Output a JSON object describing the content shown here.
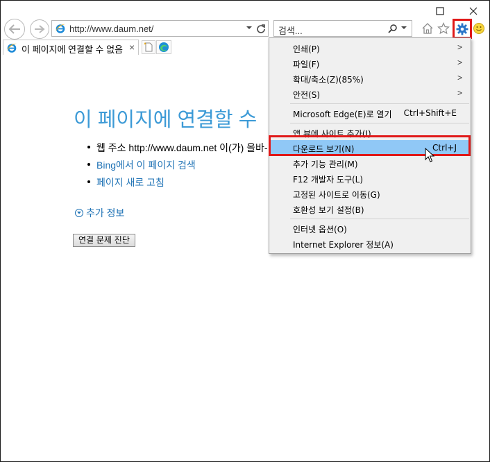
{
  "toolbar": {
    "back_label": "",
    "address_url": "http://www.daum.net/",
    "search_placeholder": "검색..."
  },
  "tab": {
    "title": "이 페이지에 연결할 수 없음",
    "close_glyph": "×"
  },
  "page": {
    "heading": "이 페이지에 연결할 수",
    "bullet_1": "웹 주소 http://www.daum.net 이(가) 올바-",
    "bullet_2": "Bing에서 이 페이지 검색",
    "bullet_3": "페이지 새로 고침",
    "more_info": "추가 정보",
    "diagnose_button": "연결 문제 진단"
  },
  "menu": {
    "items": [
      {
        "label": "인쇄(P)",
        "submenu": true
      },
      {
        "label": "파일(F)",
        "submenu": true
      },
      {
        "label": "확대/축소(Z)(85%)",
        "submenu": true
      },
      {
        "label": "안전(S)",
        "submenu": true
      },
      {
        "label": "Microsoft Edge(E)로 열기",
        "shortcut": "Ctrl+Shift+E"
      },
      {
        "label": "앱 뷰에 사이트 추가(I)"
      },
      {
        "label": "다운로드 보기(N)",
        "shortcut": "Ctrl+J",
        "highlighted": true
      },
      {
        "label": "추가 기능 관리(M)"
      },
      {
        "label": "F12 개발자 도구(L)"
      },
      {
        "label": "고정된 사이트로 이동(G)"
      },
      {
        "label": "호환성 보기 설정(B)"
      },
      {
        "label": "인터넷 옵션(O)"
      },
      {
        "label": "Internet Explorer 정보(A)"
      }
    ]
  },
  "colors": {
    "accent_blue": "#3c9ad6",
    "link_blue": "#1e72b5",
    "highlight_red": "#e01818",
    "menu_highlight": "#90c8f6",
    "gear_blue": "#2a74c7"
  },
  "icons": [
    "minimize-icon",
    "maximize-icon",
    "close-icon",
    "back-icon",
    "forward-icon",
    "ie-logo-icon",
    "dropdown-icon",
    "refresh-icon",
    "search-icon",
    "home-icon",
    "favorites-star-icon",
    "gear-icon",
    "smiley-icon",
    "new-tab-icon",
    "edge-icon",
    "cursor-icon"
  ]
}
